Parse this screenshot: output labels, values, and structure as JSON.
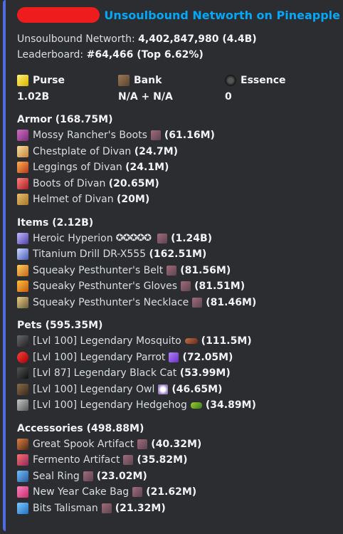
{
  "header": {
    "title": "Unsoulbound Networth on Pineapple"
  },
  "stats": {
    "networth_label": "Unsoulbound Networth: ",
    "networth_value": "4,402,847,980 (4.4B)",
    "leaderboard_label": "Leaderboard: ",
    "leaderboard_value": "#64,466 (Top 6.62%)"
  },
  "fields": [
    {
      "name": "Purse",
      "value": "1.02B",
      "icon": "gold-ingot-icon"
    },
    {
      "name": "Bank",
      "value": "N/A + N/A",
      "icon": "chest-icon"
    },
    {
      "name": "Essence",
      "value": "0",
      "icon": "wither-essence-icon"
    }
  ],
  "sections": {
    "armor": {
      "title": "Armor (168.75M)",
      "items": [
        {
          "name": "Mossy Rancher's Boots",
          "amount": "(61.16M)"
        },
        {
          "name": "Chestplate of Divan",
          "amount": "(24.7M)"
        },
        {
          "name": "Leggings of Divan",
          "amount": "(24.1M)"
        },
        {
          "name": "Boots of Divan",
          "amount": "(20.65M)"
        },
        {
          "name": "Helmet of Divan",
          "amount": "(20M)"
        }
      ]
    },
    "items": {
      "title": "Items (2.12B)",
      "items": [
        {
          "name": "Heroic Hyperion",
          "stars": "✪✪✪✪✪",
          "amount": "(1.24B)"
        },
        {
          "name": "Titanium Drill DR-X555",
          "amount": "(162.51M)"
        },
        {
          "name": "Squeaky Pesthunter's Belt",
          "amount": "(81.56M)"
        },
        {
          "name": "Squeaky Pesthunter's Gloves",
          "amount": "(81.51M)"
        },
        {
          "name": "Squeaky Pesthunter's Necklace",
          "amount": "(81.46M)"
        }
      ]
    },
    "pets": {
      "title": "Pets (595.35M)",
      "items": [
        {
          "name": "[Lvl 100] Legendary Mosquito",
          "amount": "(111.5M)"
        },
        {
          "name": "[Lvl 100] Legendary Parrot",
          "amount": "(72.05M)"
        },
        {
          "name": "[Lvl 87] Legendary Black Cat",
          "amount": "(53.99M)"
        },
        {
          "name": "[Lvl 100] Legendary Owl",
          "amount": "(46.65M)"
        },
        {
          "name": "[Lvl 100] Legendary Hedgehog",
          "amount": "(34.89M)"
        }
      ]
    },
    "accessories": {
      "title": "Accessories (498.88M)",
      "items": [
        {
          "name": "Great Spook Artifact",
          "amount": "(40.32M)"
        },
        {
          "name": "Fermento Artifact",
          "amount": "(35.82M)"
        },
        {
          "name": "Seal Ring",
          "amount": "(23.02M)"
        },
        {
          "name": "New Year Cake Bag",
          "amount": "(21.62M)"
        },
        {
          "name": "Bits Talisman",
          "amount": "(21.32M)"
        }
      ]
    }
  },
  "colors": {
    "accent_border": "#4f6de0",
    "title": "#00a8fc",
    "background": "#2b2d31",
    "redaction": "#ee1c1c"
  }
}
